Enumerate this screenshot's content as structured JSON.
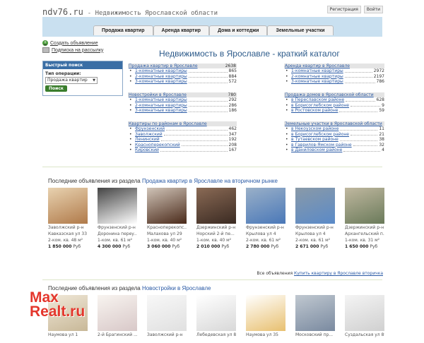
{
  "header": {
    "logo": "ndv76.ru",
    "subtitle": "- Недвижимость Ярославской области",
    "register": "Регистрация",
    "login": "Войти"
  },
  "nav": [
    "Продажа квартир",
    "Аренда квартир",
    "Дома и коттеджи",
    "Земельные участки"
  ],
  "side_links": {
    "add": "Создать объявление",
    "subscribe": "Подписка на рассылку"
  },
  "quick_search": {
    "title": "Быстрый поиск",
    "label": "Тип операции:",
    "selected": "Продажа квартир",
    "button": "Поиск"
  },
  "main_title": "Недвижимость в Ярославле - краткий каталог",
  "catalog_left": [
    {
      "title": "Продажа квартир в Ярославле",
      "count": "2638",
      "rows": [
        {
          "label": "1-комнатные квартиры",
          "count": "865"
        },
        {
          "label": "2-комнатные квартиры",
          "count": "884"
        },
        {
          "label": "3-комнатные квартиры",
          "count": "572"
        }
      ]
    },
    {
      "title": "Новостройки в Ярославле",
      "count": "780",
      "rows": [
        {
          "label": "1-комнатные квартиры",
          "count": "292"
        },
        {
          "label": "2-комнатные квартиры",
          "count": "286"
        },
        {
          "label": "3-комнатные квартиры",
          "count": "186"
        }
      ]
    },
    {
      "title": "Квартиры по районам в Ярославле",
      "count": "",
      "rows": [
        {
          "label": "Фрунзенский",
          "count": "462"
        },
        {
          "label": "Заволжский",
          "count": "347"
        },
        {
          "label": "Ленинский",
          "count": "192"
        },
        {
          "label": "Красноперекопский",
          "count": "208"
        },
        {
          "label": "Кировский",
          "count": "167"
        }
      ]
    }
  ],
  "catalog_right": [
    {
      "title": "Аренда квартир в Ярославле",
      "count": "",
      "rows": [
        {
          "label": "1-комнатные квартиры",
          "count": "2972"
        },
        {
          "label": "2-комнатные квартиры",
          "count": "2197"
        },
        {
          "label": "3-комнатные квартиры",
          "count": "786"
        }
      ]
    },
    {
      "title": "Продажа домов в Ярославской области",
      "count": "",
      "rows": [
        {
          "label": "в Переславском районе",
          "count": "628"
        },
        {
          "label": "в Борисоглебском районе",
          "count": "9"
        },
        {
          "label": "в Ростовском районе",
          "count": "59"
        }
      ]
    },
    {
      "title": "Земельные участки в Ярославской области",
      "count": "",
      "rows": [
        {
          "label": "в Некоузском районе",
          "count": "11"
        },
        {
          "label": "в Борисоглебском районе",
          "count": "21"
        },
        {
          "label": "в Тутаевском районе",
          "count": "38"
        },
        {
          "label": "в Гаврилов-Ямском районе",
          "count": "32"
        },
        {
          "label": "в Даниловском районе",
          "count": "4"
        }
      ]
    }
  ],
  "section1": {
    "prefix": "Последние объявления из раздела",
    "link": "Продажа квартир в Ярославле на вторичном рынке",
    "more_prefix": "Все объявления",
    "more_link": "Купить квартиру в Ярославле вторичка",
    "cards": [
      {
        "district": "Заволжский р-н",
        "addr": "Кавказская ул 33",
        "desc": "2-ком. кв. 48 м²",
        "price": "1 850 000",
        "cur": "Руб",
        "img": [
          "#b07a4a",
          "#e8d2b0"
        ]
      },
      {
        "district": "Фрунзенский р-н",
        "addr": "Доронина переу...",
        "desc": "1-ком. кв. 61 м²",
        "price": "4 300 000",
        "cur": "Руб",
        "img": [
          "#ffffff",
          "#444444"
        ]
      },
      {
        "district": "Красноперекопс...",
        "addr": "Малахова ул 29",
        "desc": "1-ком. кв. 40 м²",
        "price": "3 060 000",
        "cur": "Руб",
        "img": [
          "#4a2a1a",
          "#d0c4b8"
        ]
      },
      {
        "district": "Дзержинский р-н",
        "addr": "Норский 2-й пе...",
        "desc": "1-ком. кв. 40 м²",
        "price": "2 010 000",
        "cur": "Руб",
        "img": [
          "#3a2a22",
          "#8a6a55"
        ]
      },
      {
        "district": "Фрунзенский р-н",
        "addr": "Крылова ул 4",
        "desc": "2-ком. кв. 61 м²",
        "price": "2 780 000",
        "cur": "Руб",
        "img": [
          "#4a78b8",
          "#9ab0c8"
        ]
      },
      {
        "district": "Фрунзенский р-н",
        "addr": "Крылова ул 4",
        "desc": "2-ком. кв. 61 м²",
        "price": "2 671 000",
        "cur": "Руб",
        "img": [
          "#5a8ac8",
          "#8a9aa8"
        ]
      },
      {
        "district": "Дзержинский р-н",
        "addr": "Архангельский п...",
        "desc": "1-ком. кв. 31 м²",
        "price": "1 650 000",
        "cur": "Руб",
        "img": [
          "#6a7a5a",
          "#c0b8a0"
        ]
      }
    ]
  },
  "section2": {
    "prefix": "Последние объявления из раздела",
    "link": "Новостройки в Ярославле",
    "cards": [
      {
        "district": "Наумова ул 1",
        "img": [
          "#c8b898",
          "#f0e8d8"
        ]
      },
      {
        "district": "2-й Брагинский ...",
        "img": [
          "#d8c8c8",
          "#f8f4f0"
        ]
      },
      {
        "district": "Заволжский р-н",
        "img": [
          "#e0e0e0",
          "#f8f8f8"
        ]
      },
      {
        "district": "Лебедевская ул 8",
        "img": [
          "#d8d8d8",
          "#ffffff"
        ]
      },
      {
        "district": "Наумова ул 35",
        "img": [
          "#e8c070",
          "#ffffff"
        ]
      },
      {
        "district": "Московский пр...",
        "img": [
          "#7a8aa0",
          "#c0c8d0"
        ]
      },
      {
        "district": "Суздальская ул 89",
        "img": [
          "#d0d0d0",
          "#f4f4f4"
        ]
      }
    ]
  },
  "watermark": {
    "line1": "Max",
    "line2": "Realt.ru"
  }
}
